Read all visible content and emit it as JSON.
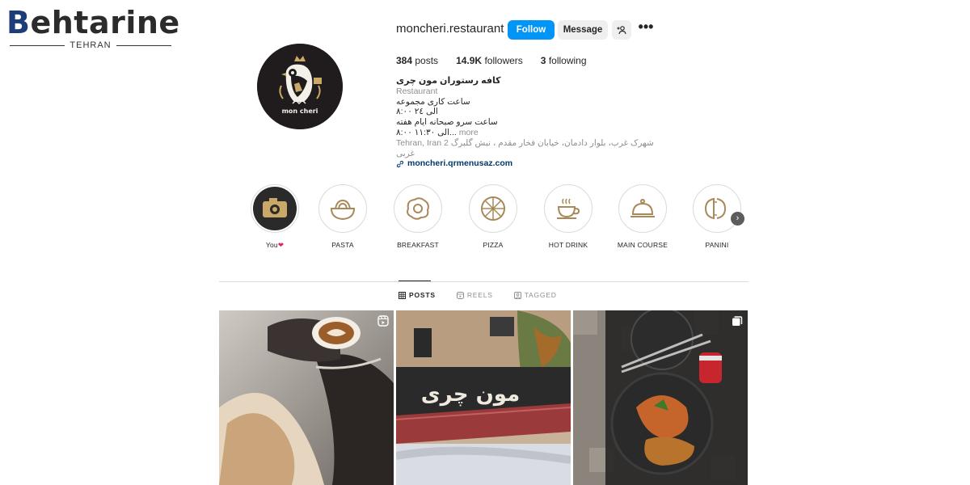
{
  "watermark": {
    "brand_b": "B",
    "brand_rest": "ehtarine",
    "city": "TEHRAN"
  },
  "profile": {
    "username": "moncheri.restaurant",
    "follow_label": "Follow",
    "message_label": "Message",
    "stats": [
      {
        "value": "384",
        "label": "posts"
      },
      {
        "value": "14.9K",
        "label": "followers"
      },
      {
        "value": "3",
        "label": "following"
      }
    ],
    "bio": {
      "name": "کافه رستوران مون چری",
      "category": "Restaurant",
      "line1": "ساعت کاری مجموعه",
      "line2": "۸:۰۰ الی ۲٤",
      "line3": "ساعت سرو صبحانه ایام هفته",
      "line4": "۸:۰۰ الی ۱۱:۳۰...",
      "more": "more",
      "address_city": "Tehran, Iran",
      "address": "شهرک غرب، بلوار دادمان، خیابان فخار مقدم ، نبش گلبرگ 2 غربی",
      "link": "moncheri.qrmenusaz.com"
    },
    "avatar_brand": "mon cheri"
  },
  "highlights": [
    {
      "label": "You",
      "icon": "camera-icon"
    },
    {
      "label": "PASTA",
      "icon": "pasta-bowl-icon"
    },
    {
      "label": "BREAKFAST",
      "icon": "fried-egg-icon"
    },
    {
      "label": "PIZZA",
      "icon": "pizza-icon"
    },
    {
      "label": "HOT DRINK",
      "icon": "coffee-cup-icon"
    },
    {
      "label": "MAIN COURSE",
      "icon": "cloche-icon"
    },
    {
      "label": "PANINI",
      "icon": "panini-icon"
    }
  ],
  "tabs": [
    {
      "label": "POSTS",
      "icon": "grid-icon",
      "active": true
    },
    {
      "label": "REELS",
      "icon": "reels-icon",
      "active": false
    },
    {
      "label": "TAGGED",
      "icon": "tagged-icon",
      "active": false
    }
  ],
  "posts": [
    {
      "badge": "reel-icon",
      "shop_sign": ""
    },
    {
      "badge": "",
      "shop_sign": "مون چری"
    },
    {
      "badge": "carousel-icon",
      "shop_sign": ""
    }
  ],
  "colors": {
    "follow": "#0095f6",
    "link": "#00376b",
    "highlight_gold": "#a8895a"
  }
}
